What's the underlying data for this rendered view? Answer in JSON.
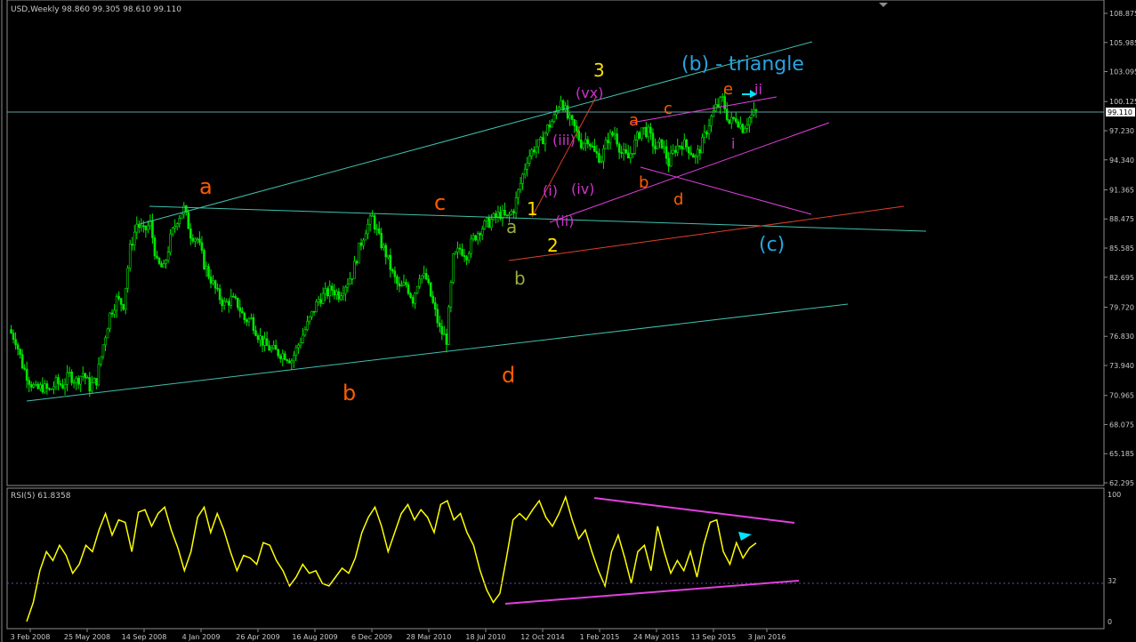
{
  "header": {
    "symbol_text": "USD,Weekly  98.860 99.305 98.610 99.110",
    "rsi_text": "RSI(5) 61.8358"
  },
  "current_price": "99.110",
  "chart_data": [
    {
      "type": "candlestick",
      "title": "USD,Weekly",
      "ohlc": {
        "open": 98.86,
        "high": 99.305,
        "low": 98.61,
        "close": 99.11
      },
      "ylim": [
        62.295,
        108.875
      ],
      "price_ticks": [
        "108.875",
        "105.985",
        "103.095",
        "100.125",
        "97.230",
        "94.340",
        "91.365",
        "88.475",
        "85.585",
        "82.695",
        "79.720",
        "76.830",
        "73.940",
        "70.965",
        "68.075",
        "65.185",
        "62.295"
      ],
      "date_ticks": [
        "3 Feb 2008",
        "25 May 2008",
        "14 Sep 2008",
        "4 Jan 2009",
        "26 Apr 2009",
        "16 Aug 2009",
        "6 Dec 2009",
        "28 Mar 2010",
        "18 Jul 2010",
        "12 Oct 2014",
        "1 Feb 2015",
        "24 May 2015",
        "13 Sep 2015",
        "3 Jan 2016"
      ],
      "price_path": [
        [
          0,
          77.5
        ],
        [
          3,
          76.5
        ],
        [
          6,
          74.0
        ],
        [
          9,
          72.5
        ],
        [
          12,
          71.5
        ],
        [
          15,
          71.8
        ],
        [
          18,
          71.4
        ],
        [
          21,
          72.2
        ],
        [
          24,
          72.0
        ],
        [
          27,
          73.0
        ],
        [
          30,
          72.4
        ],
        [
          33,
          73.2
        ],
        [
          36,
          71.8
        ],
        [
          39,
          72.5
        ],
        [
          42,
          76.0
        ],
        [
          45,
          79.0
        ],
        [
          48,
          80.5
        ],
        [
          51,
          80.0
        ],
        [
          54,
          85.5
        ],
        [
          57,
          88.0
        ],
        [
          60,
          87.2
        ],
        [
          63,
          88.0
        ],
        [
          66,
          84.0
        ],
        [
          69,
          83.5
        ],
        [
          72,
          86.5
        ],
        [
          75,
          88.5
        ],
        [
          78,
          89.5
        ],
        [
          81,
          87.0
        ],
        [
          84,
          86.5
        ],
        [
          87,
          84.0
        ],
        [
          90,
          82.5
        ],
        [
          93,
          81.0
        ],
        [
          96,
          80.0
        ],
        [
          99,
          80.5
        ],
        [
          102,
          80.0
        ],
        [
          105,
          78.5
        ],
        [
          108,
          78.5
        ],
        [
          111,
          77.0
        ],
        [
          114,
          76.0
        ],
        [
          117,
          75.5
        ],
        [
          120,
          75.2
        ],
        [
          123,
          75.0
        ],
        [
          126,
          74.5
        ],
        [
          129,
          76.0
        ],
        [
          132,
          77.5
        ],
        [
          135,
          79.0
        ],
        [
          138,
          80.5
        ],
        [
          141,
          81.0
        ],
        [
          144,
          81.5
        ],
        [
          147,
          81.0
        ],
        [
          150,
          82.0
        ],
        [
          153,
          83.0
        ],
        [
          156,
          85.5
        ],
        [
          159,
          87.5
        ],
        [
          162,
          88.6
        ],
        [
          165,
          86.5
        ],
        [
          168,
          85.0
        ],
        [
          171,
          83.0
        ],
        [
          174,
          81.5
        ],
        [
          177,
          82.0
        ],
        [
          180,
          80.5
        ],
        [
          183,
          83.0
        ],
        [
          186,
          82.5
        ],
        [
          189,
          80.0
        ],
        [
          192,
          77.5
        ],
        [
          195,
          76.5
        ],
        [
          198,
          84.5
        ],
        [
          201,
          85.5
        ],
        [
          204,
          85.0
        ],
        [
          207,
          86.5
        ],
        [
          210,
          87.5
        ],
        [
          213,
          88.0
        ],
        [
          216,
          88.5
        ],
        [
          219,
          89.0
        ],
        [
          222,
          88.5
        ],
        [
          225,
          89.5
        ],
        [
          228,
          92.0
        ],
        [
          231,
          94.5
        ],
        [
          234,
          95.5
        ],
        [
          237,
          96.0
        ],
        [
          240,
          97.5
        ],
        [
          243,
          98.5
        ],
        [
          246,
          100.5
        ],
        [
          249,
          98.5
        ],
        [
          252,
          97.5
        ],
        [
          255,
          96.0
        ],
        [
          258,
          96.5
        ],
        [
          261,
          95.0
        ],
        [
          264,
          94.5
        ],
        [
          267,
          96.5
        ],
        [
          270,
          97.0
        ],
        [
          273,
          95.0
        ],
        [
          276,
          94.5
        ],
        [
          279,
          96.0
        ],
        [
          282,
          97.5
        ],
        [
          285,
          97.0
        ],
        [
          288,
          95.5
        ],
        [
          291,
          96.0
        ],
        [
          294,
          94.0
        ],
        [
          297,
          95.5
        ],
        [
          300,
          96.0
        ],
        [
          303,
          95.5
        ],
        [
          306,
          94.5
        ],
        [
          309,
          96.0
        ],
        [
          312,
          98.0
        ],
        [
          315,
          99.5
        ],
        [
          318,
          100.3
        ],
        [
          321,
          98.0
        ],
        [
          324,
          98.5
        ],
        [
          327,
          97.5
        ],
        [
          330,
          98.5
        ],
        [
          333,
          99.1
        ]
      ],
      "annotations": [
        {
          "text": "a",
          "color": "#ff5a00"
        },
        {
          "text": "b",
          "color": "#ff5a00"
        },
        {
          "text": "c",
          "color": "#ff5a00"
        },
        {
          "text": "d",
          "color": "#ff5a00"
        },
        {
          "text": "a",
          "color": "#9aad3c"
        },
        {
          "text": "b",
          "color": "#9aad3c"
        },
        {
          "text": "1",
          "color": "#ffe000"
        },
        {
          "text": "2",
          "color": "#ffe000"
        },
        {
          "text": "3",
          "color": "#ffe000"
        },
        {
          "text": "(i)",
          "color": "#cc33cc"
        },
        {
          "text": "(ii)",
          "color": "#cc33cc"
        },
        {
          "text": "(iii)",
          "color": "#cc33cc"
        },
        {
          "text": "(iv)",
          "color": "#cc33cc"
        },
        {
          "text": "(vx)",
          "color": "#cc33cc"
        },
        {
          "text": "a",
          "color": "#ff5a00"
        },
        {
          "text": "b",
          "color": "#ff5a00"
        },
        {
          "text": "c",
          "color": "#ff5a00"
        },
        {
          "text": "d",
          "color": "#ff5a00"
        },
        {
          "text": "e",
          "color": "#ff5a00"
        },
        {
          "text": "i",
          "color": "#cc33cc"
        },
        {
          "text": "ii",
          "color": "#cc33cc"
        },
        {
          "text": "(b) - triangle",
          "color": "#29a3e0"
        },
        {
          "text": "(c)",
          "color": "#29a3e0"
        }
      ]
    },
    {
      "type": "line",
      "title": "RSI(5) 61.8358",
      "ylim": [
        0,
        100
      ],
      "ticks": [
        "100",
        "32",
        "0"
      ],
      "level_line": 32,
      "values": [
        0,
        15,
        40,
        55,
        48,
        60,
        52,
        38,
        45,
        60,
        55,
        72,
        85,
        68,
        80,
        78,
        55,
        86,
        88,
        75,
        85,
        90,
        72,
        58,
        40,
        55,
        82,
        90,
        70,
        85,
        72,
        55,
        40,
        52,
        50,
        45,
        62,
        60,
        48,
        40,
        28,
        35,
        45,
        38,
        40,
        30,
        28,
        35,
        42,
        38,
        50,
        70,
        82,
        90,
        75,
        55,
        70,
        85,
        92,
        80,
        88,
        82,
        70,
        92,
        95,
        80,
        85,
        70,
        60,
        40,
        25,
        15,
        22,
        50,
        80,
        85,
        80,
        88,
        95,
        82,
        75,
        85,
        98,
        80,
        65,
        72,
        55,
        40,
        28,
        55,
        68,
        50,
        30,
        55,
        60,
        40,
        75,
        55,
        38,
        48,
        40,
        55,
        35,
        60,
        78,
        80,
        55,
        45,
        62,
        50,
        58,
        61.8
      ]
    }
  ],
  "colors": {
    "background": "#000000",
    "candle": "#00e600",
    "grid_horizontal": "#5f9ea0",
    "trendline": "#40c0b0",
    "rsi_line": "#ffff00",
    "triangle_lines": "#e040e0",
    "orange_line": "#e0402a",
    "cyan_arrow": "#00e5ff"
  }
}
